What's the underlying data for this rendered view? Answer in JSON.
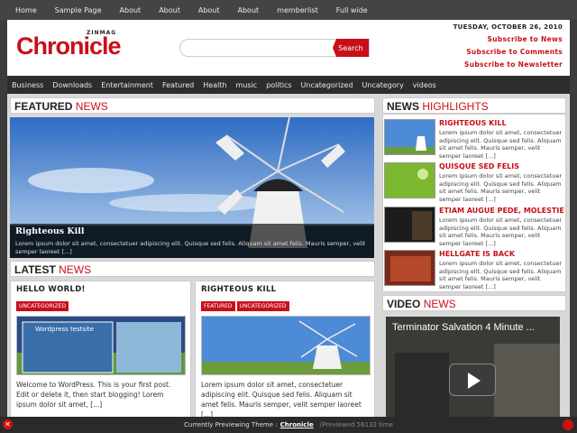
{
  "top_nav": [
    "Home",
    "Sample Page",
    "About",
    "About",
    "About",
    "About",
    "memberlist",
    "Full wide"
  ],
  "logo": {
    "small": "ZINMAG",
    "main": "Chronicle"
  },
  "search": {
    "placeholder": "",
    "button": "Search"
  },
  "header_right": {
    "date": "TUESDAY, OCTOBER 26, 2010",
    "links": [
      "Subscribe to News",
      "Subscribe to Comments",
      "Subscribe to Newsletter"
    ]
  },
  "categories": [
    "Business",
    "Downloads",
    "Entertainment",
    "Featured",
    "Health",
    "music",
    "politics",
    "Uncategorized",
    "Uncategory",
    "videos"
  ],
  "featured": {
    "title_bold": "FEATURED",
    "title_red": "NEWS",
    "slide_title": "Righteous Kill",
    "slide_text": "Lorem ipsum dolor sit amet, consectetuer adipiscing elit. Quisque sed felis. Aliquam sit amet felis. Mauris semper, velit semper laoreet [...]"
  },
  "latest": {
    "title_bold": "LATEST",
    "title_red": "NEWS",
    "posts": [
      {
        "title": "HELLO WORLD!",
        "tags": [
          "UNCATEGORIZED"
        ],
        "thumb_label": "Wordpress testsite",
        "excerpt": "Welcome to WordPress. This is your first post. Edit or delete it, then start blogging! Lorem ipsum dolor sit amet, [...]"
      },
      {
        "title": "RIGHTEOUS KILL",
        "tags": [
          "FEATURED",
          "UNCATEGORIZED"
        ],
        "excerpt": "Lorem ipsum dolor sit amet, consectetuer adipiscing elit. Quisque sed felis. Aliquam sit amet felis. Mauris semper, velit semper laoreet [...]"
      }
    ]
  },
  "highlights": {
    "title_bold": "NEWS",
    "title_red": "HIGHLIGHTS",
    "items": [
      {
        "title": "RIGHTEOUS KILL",
        "text": "Lorem ipsum dolor sit amet, consectetuer adipiscing elit. Quisque sed felis. Aliquam sit amet felis. Mauris semper, velit semper laoreet [...]"
      },
      {
        "title": "QUISQUE SED FELIS",
        "text": "Lorem ipsum dolor sit amet, consectetuer adipiscing elit. Quisque sed felis. Aliquam sit amet felis. Mauris semper, velit semper laoreet [...]"
      },
      {
        "title": "ETIAM AUGUE PEDE, MOLESTIE",
        "text": "Lorem ipsum dolor sit amet, consectetuer adipiscing elit. Quisque sed felis. Aliquam sit amet felis. Mauris semper, velit semper laoreet [...]"
      },
      {
        "title": "HELLGATE IS BACK",
        "text": "Lorem ipsum dolor sit amet, consectetuer adipiscing elit. Quisque sed felis. Aliquam sit amet felis. Mauris semper, velit semper laoreet [...]"
      }
    ]
  },
  "video": {
    "title_bold": "VIDEO",
    "title_red": "NEWS",
    "clip_title": "Terminator Salvation 4 Minute ..."
  },
  "preview_bar": {
    "label": "Currently Previewing Theme :",
    "theme": "Chronicle",
    "meta": "(Previewed 56132 time"
  },
  "colors": {
    "accent": "#c8101a",
    "nav": "#444444",
    "background": "#3b3b3b"
  },
  "icons": {
    "close": "close-icon",
    "play": "play-icon"
  }
}
